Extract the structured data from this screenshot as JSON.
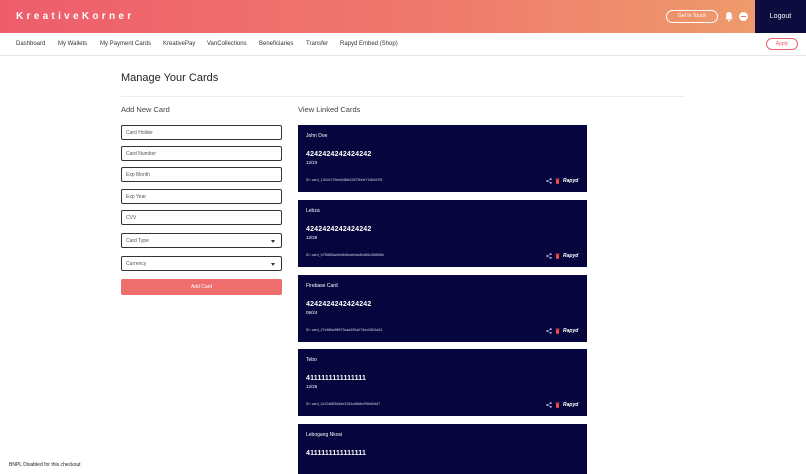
{
  "header": {
    "brand": "KreativeKorner",
    "get_in_touch": "Get In Touch",
    "logout": "Logout",
    "icons": [
      "bell-icon",
      "user-avatar-icon"
    ]
  },
  "nav": {
    "items": [
      "Dashboard",
      "My Wallets",
      "My Payment Cards",
      "KreativePay",
      "VanCollections",
      "Beneficiaries",
      "Transfer",
      "Rapyd Embed (Shop)"
    ],
    "apply": "Apply"
  },
  "page": {
    "title": "Manage Your Cards",
    "add_heading": "Add New Card",
    "view_heading": "View Linked Cards"
  },
  "form": {
    "card_holder_placeholder": "Card Holder",
    "card_number_placeholder": "Card Number",
    "exp_month_placeholder": "Exp Month",
    "exp_year_placeholder": "Exp Year",
    "cvv_placeholder": "CVV",
    "card_type": "Card Type",
    "currency": "Currency",
    "submit": "Add Card"
  },
  "cards": [
    {
      "holder": "John Doe",
      "number": "4242424242424242",
      "expiry": "12/23",
      "id": "ID: card_13b2e739eb5d8fe22879b0e716fcfd7f5",
      "brand": "Rapyd"
    },
    {
      "holder": "Lebza",
      "number": "4242424242424242",
      "expiry": "12/28",
      "id": "ID: card_b7f5865ac9e6b6bdebda4bd85c3bf608e",
      "brand": "Rapyd"
    },
    {
      "holder": "Firebase Card",
      "number": "4242424242424242",
      "expiry": "09/24",
      "id": "ID: card_27e68be8ff973caa390a073ec0804a34",
      "brand": "Rapyd"
    },
    {
      "holder": "Tebo",
      "number": "4111111111111111",
      "expiry": "12/25",
      "id": "ID: card_0c12d6ff3b5de2264cdf68e2f9b60dd7",
      "brand": "Rapyd"
    },
    {
      "holder": "Lebogang Nkosi",
      "number": "4111111111111111",
      "expiry": "",
      "id": "",
      "brand": ""
    }
  ],
  "colors": {
    "header_gradient_start": "#ee5d6c",
    "header_gradient_end": "#eea06c",
    "card_bg": "#07053d",
    "logout_bg": "#0d0c3f",
    "accent": "#ee6e6e"
  },
  "footer": {
    "text": "BNPL Disabled for this checkout"
  }
}
